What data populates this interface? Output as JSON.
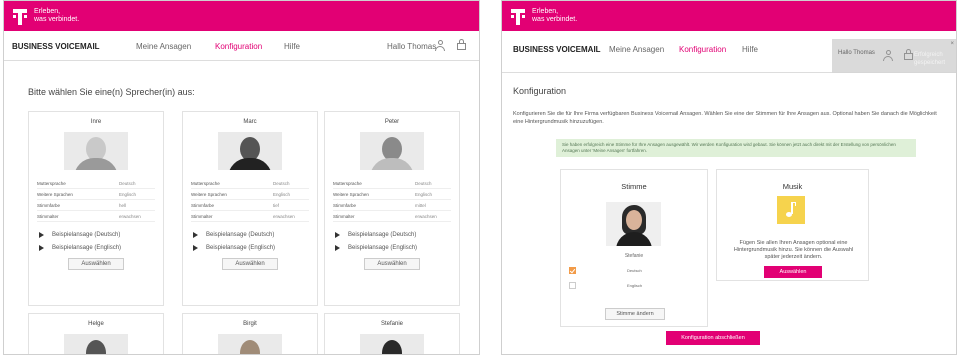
{
  "brand": {
    "slogan_line1": "Erleben,",
    "slogan_line2": "was verbindet.",
    "color": "#e20074"
  },
  "nav": {
    "app_name": "BUSINESS VOICEMAIL",
    "links": [
      "Meine Ansagen",
      "Konfiguration",
      "Hilfe"
    ],
    "active": "Konfiguration",
    "greeting": "Hallo Thomas"
  },
  "left": {
    "heading": "Bitte wählen Sie eine(n) Sprecher(in) aus:",
    "attr_labels": [
      "Muttersprache",
      "Weitere Sprachen",
      "Stimmfarbe",
      "Stimmalter"
    ],
    "speakers": [
      {
        "name": "Inre",
        "values": [
          "Deutsch",
          "Englisch",
          "hell",
          "erwachsen"
        ]
      },
      {
        "name": "Marc",
        "values": [
          "Deutsch",
          "Englisch",
          "tief",
          "erwachsen"
        ]
      },
      {
        "name": "Peter",
        "values": [
          "Deutsch",
          "Englisch",
          "mittel",
          "erwachsen"
        ]
      }
    ],
    "sample_de": "Beispielansage (Deutsch)",
    "sample_en": "Beispielansage (Englisch)",
    "select_button": "Auswählen",
    "next_speakers": [
      "Helge",
      "Birgit",
      "Stefanie"
    ]
  },
  "right": {
    "title": "Konfiguration",
    "description": "Konfigurieren Sie die für Ihre Firma verfügbaren Business Voicemail Ansagen. Wählen Sie eine der Stimmen für Ihre Ansagen aus. Optional haben Sie danach die Möglichkeit eine Hintergrundmusik hinzuzufügen.",
    "notice": "Sie haben erfolgreich eine Stimme für Ihre Ansagen ausgewählt. Wir werden Konfiguration wird gebaut. Sie können jetzt auch direkt mit der Erstellung von persönlichen Ansagen unter 'Meine Ansagen' fortfahren.",
    "voice_box": {
      "title": "Stimme",
      "speaker": "Stefanie",
      "languages": [
        {
          "label": "Deutsch",
          "checked": true
        },
        {
          "label": "Englisch",
          "checked": false
        }
      ],
      "change_button": "Stimme ändern"
    },
    "music_box": {
      "title": "Musik",
      "description": "Fügen Sie allen Ihren Ansagen optional eine Hintergrundmusik hinzu. Sie können die Auswahl später jederzeit ändern.",
      "select_button": "Auswählen"
    },
    "finish_button": "Konfiguration abschließen",
    "toast": {
      "title": "Hallo Thomas",
      "ghost": "Erfolgreich gespeichert",
      "close": "×"
    }
  }
}
